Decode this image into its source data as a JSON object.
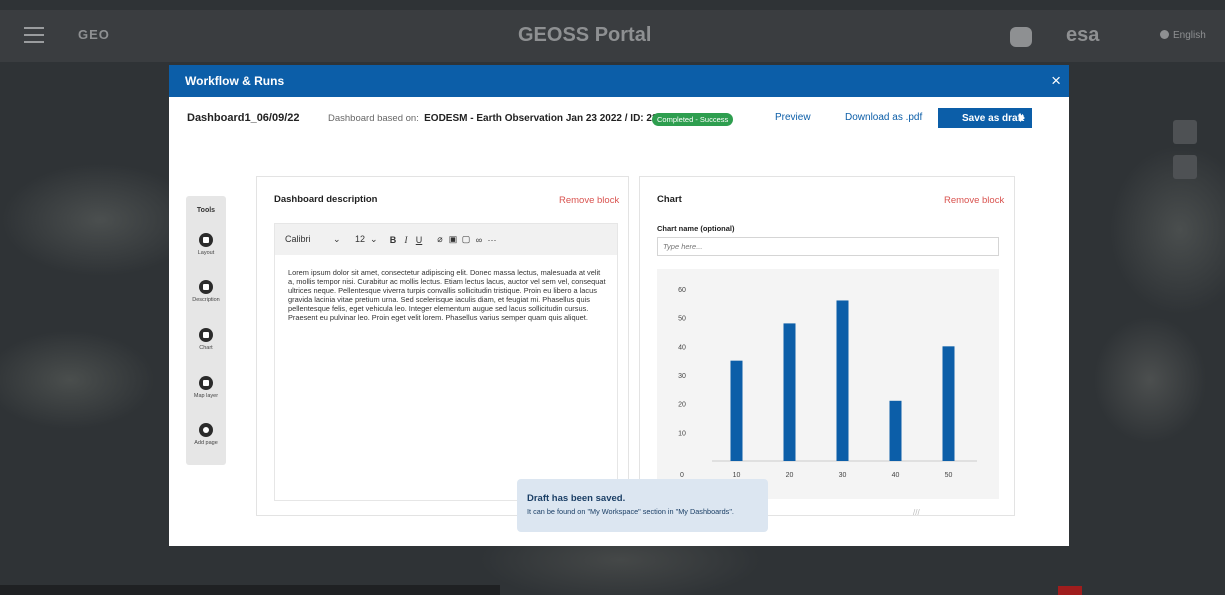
{
  "portal": {
    "title": "GEOSS Portal",
    "language": "English"
  },
  "modal": {
    "title": "Workflow & Runs",
    "close_symbol": "×"
  },
  "dashboard": {
    "name": "Dashboard1_06/09/22",
    "based_on_label": "Dashboard based on:",
    "based_on_value": "EODESM - Earth Observation Jan 23 2022 / ID: 2354",
    "status_badge": "Completed - Success",
    "preview_label": "Preview",
    "download_label": "Download as .pdf",
    "save_label": "Save as draft"
  },
  "tools": {
    "title": "Tools",
    "items": [
      {
        "label": "Layout"
      },
      {
        "label": "Description"
      },
      {
        "label": "Chart"
      },
      {
        "label": "Map layer"
      },
      {
        "label": "Add page"
      }
    ]
  },
  "description_block": {
    "title": "Dashboard description",
    "remove_label": "Remove block",
    "font": "Calibri",
    "font_size": "12",
    "text": "Lorem ipsum dolor sit amet, consectetur adipiscing elit. Donec massa lectus, malesuada at velit a, mollis tempor nisi. Curabitur ac mollis lectus. Etiam lectus lacus, auctor vel sem vel, consequat ultrices neque. Pellentesque viverra turpis convallis sollicitudin tristique. Proin eu libero a lacus gravida lacinia vitae pretium urna. Sed scelerisque iaculis diam, et feugiat mi. Phasellus quis pellentesque felis, eget vehicula leo. Integer elementum augue sed lacus sollicitudin cursus. Praesent eu pulvinar leo. Proin eget velit lorem. Phasellus varius semper quam quis aliquet."
  },
  "chart_block": {
    "title": "Chart",
    "remove_label": "Remove block",
    "name_label": "Chart name (optional)",
    "name_placeholder": "Type here..."
  },
  "chart_data": {
    "type": "bar",
    "categories": [
      "10",
      "20",
      "30",
      "40",
      "50"
    ],
    "values": [
      35,
      48,
      56,
      21,
      40
    ],
    "ylim": [
      0,
      60
    ],
    "yticks": [
      0,
      10,
      20,
      30,
      40,
      50,
      60
    ],
    "grid": false,
    "bar_color": "#0c5ea8"
  },
  "toast": {
    "title": "Draft has been saved.",
    "body": "It can be found on \"My Workspace\" section in \"My Dashboards\"."
  },
  "colors": {
    "primary": "#0c5ea8",
    "success": "#2e9e4f",
    "danger": "#d9534f"
  }
}
